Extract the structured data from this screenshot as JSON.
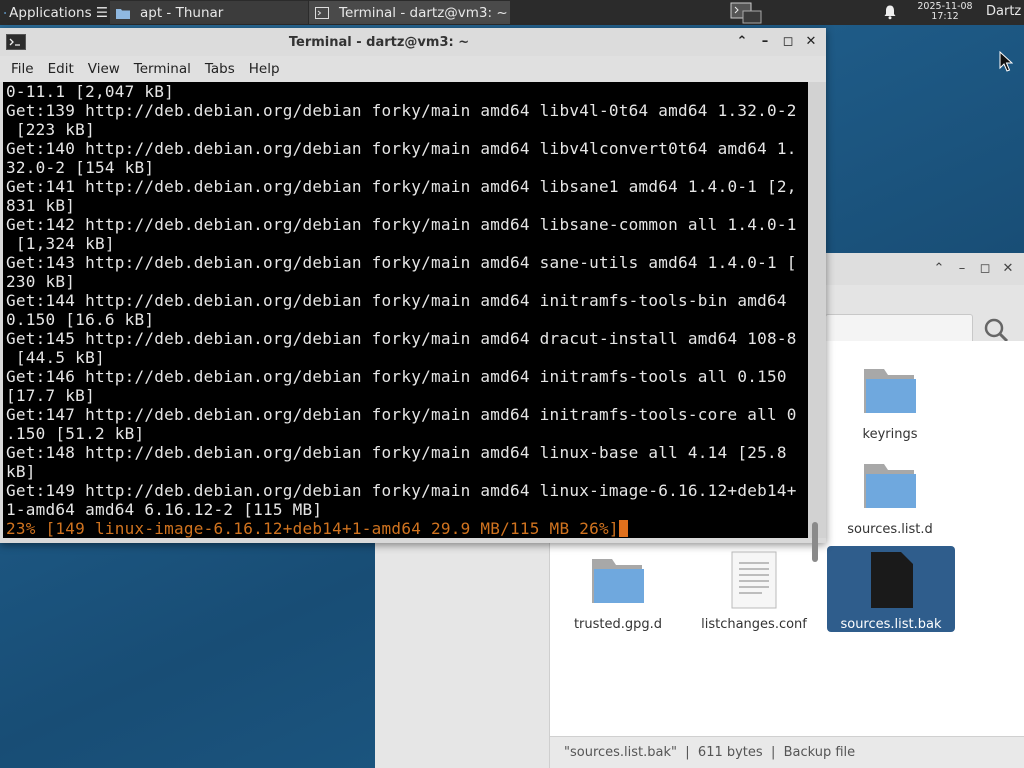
{
  "panel": {
    "apps_label": "Applications ☰",
    "tasks": [
      {
        "label": "apt - Thunar",
        "icon": "folder-icon"
      },
      {
        "label": "Terminal - dartz@vm3: ~",
        "icon": "terminal-icon"
      }
    ],
    "clock_date": "2025-11-08",
    "clock_time": "17:12",
    "user": "Dartz"
  },
  "terminal": {
    "title": "Terminal - dartz@vm3: ~",
    "menu": [
      "File",
      "Edit",
      "View",
      "Terminal",
      "Tabs",
      "Help"
    ],
    "lines": [
      "0-11.1 [2,047 kB]",
      "Get:139 http://deb.debian.org/debian forky/main amd64 libv4l-0t64 amd64 1.32.0-2",
      " [223 kB]",
      "Get:140 http://deb.debian.org/debian forky/main amd64 libv4lconvert0t64 amd64 1.",
      "32.0-2 [154 kB]",
      "Get:141 http://deb.debian.org/debian forky/main amd64 libsane1 amd64 1.4.0-1 [2,",
      "831 kB]",
      "Get:142 http://deb.debian.org/debian forky/main amd64 libsane-common all 1.4.0-1",
      " [1,324 kB]",
      "Get:143 http://deb.debian.org/debian forky/main amd64 sane-utils amd64 1.4.0-1 [",
      "230 kB]",
      "Get:144 http://deb.debian.org/debian forky/main amd64 initramfs-tools-bin amd64",
      "0.150 [16.6 kB]",
      "Get:145 http://deb.debian.org/debian forky/main amd64 dracut-install amd64 108-8",
      " [44.5 kB]",
      "Get:146 http://deb.debian.org/debian forky/main amd64 initramfs-tools all 0.150",
      "[17.7 kB]",
      "Get:147 http://deb.debian.org/debian forky/main amd64 initramfs-tools-core all 0",
      ".150 [51.2 kB]",
      "Get:148 http://deb.debian.org/debian forky/main amd64 linux-base all 4.14 [25.8",
      "kB]",
      "Get:149 http://deb.debian.org/debian forky/main amd64 linux-image-6.16.12+deb14+",
      "1-amd64 amd64 6.16.12-2 [115 MB]"
    ],
    "progress_line": "23% [149 linux-image-6.16.12+deb14+1-amd64 29.9 MB/115 MB 26%]",
    "progress_color": "#d0731f"
  },
  "thunar": {
    "files": [
      {
        "name": "keyrings",
        "icon": "folder-icon"
      },
      {
        "name": "sources.list.d",
        "icon": "folder-icon"
      },
      {
        "name": "trusted.gpg.d",
        "icon": "folder-icon"
      },
      {
        "name": "listchanges.conf",
        "icon": "text-file-icon"
      },
      {
        "name": "sources.list.bak",
        "icon": "file-icon",
        "selected": true
      }
    ],
    "status": "\"sources.list.bak\"  |  611 bytes  |  Backup file",
    "selection_color": "#2f5d8c"
  }
}
